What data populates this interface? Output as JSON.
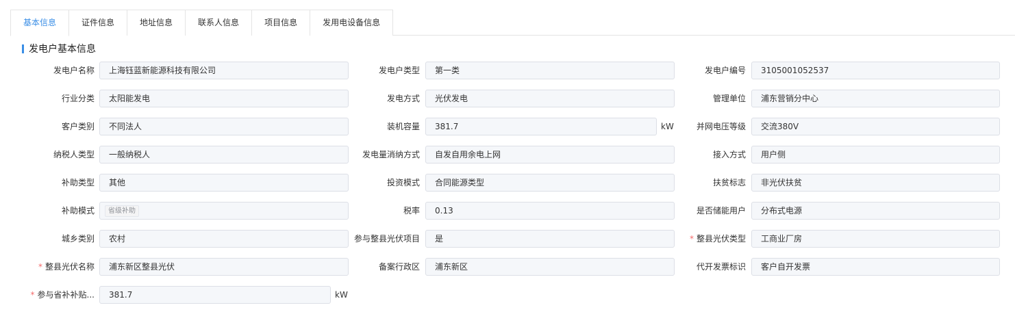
{
  "tabs": [
    {
      "label": "基本信息"
    },
    {
      "label": "证件信息"
    },
    {
      "label": "地址信息"
    },
    {
      "label": "联系人信息"
    },
    {
      "label": "项目信息"
    },
    {
      "label": "发用电设备信息"
    }
  ],
  "section_title": "发电户基本信息",
  "required_mark": "*",
  "unit": "kW",
  "fields": {
    "name": {
      "label": "发电户名称",
      "value": "上海钰蓝新能源科技有限公司"
    },
    "gen_type": {
      "label": "发电户类型",
      "value": "第一类"
    },
    "gen_no": {
      "label": "发电户编号",
      "value": "3105001052537"
    },
    "industry": {
      "label": "行业分类",
      "value": "太阳能发电"
    },
    "gen_method": {
      "label": "发电方式",
      "value": "光伏发电"
    },
    "mgmt_unit": {
      "label": "管理单位",
      "value": "浦东营销分中心"
    },
    "cust_cat": {
      "label": "客户类别",
      "value": "不同法人"
    },
    "capacity": {
      "label": "装机容量",
      "value": "381.7"
    },
    "voltage": {
      "label": "并网电压等级",
      "value": "交流380V"
    },
    "taxpayer": {
      "label": "纳税人类型",
      "value": "一般纳税人"
    },
    "consume": {
      "label": "发电量消纳方式",
      "value": "自发自用余电上网"
    },
    "access": {
      "label": "接入方式",
      "value": "用户侧"
    },
    "subsidy_type": {
      "label": "补助类型",
      "value": "其他"
    },
    "invest": {
      "label": "投资模式",
      "value": "合同能源类型"
    },
    "poverty": {
      "label": "扶贫标志",
      "value": "非光伏扶贫"
    },
    "subsidy_mode": {
      "label": "补助模式",
      "value": "省级补助"
    },
    "tax_rate": {
      "label": "税率",
      "value": "0.13"
    },
    "storage": {
      "label": "是否储能用户",
      "value": "分布式电源"
    },
    "urban": {
      "label": "城乡类别",
      "value": "农村"
    },
    "county_pv": {
      "label": "参与整县光伏项目",
      "value": "是"
    },
    "county_pv_type": {
      "label": "整县光伏类型",
      "value": "工商业厂房"
    },
    "county_pv_name": {
      "label": "整县光伏名称",
      "value": "浦东新区整县光伏"
    },
    "district": {
      "label": "备案行政区",
      "value": "浦东新区"
    },
    "invoice": {
      "label": "代开发票标识",
      "value": "客户自开发票"
    },
    "prov_subsidy": {
      "label": "参与省补补贴...",
      "value": "381.7"
    }
  }
}
